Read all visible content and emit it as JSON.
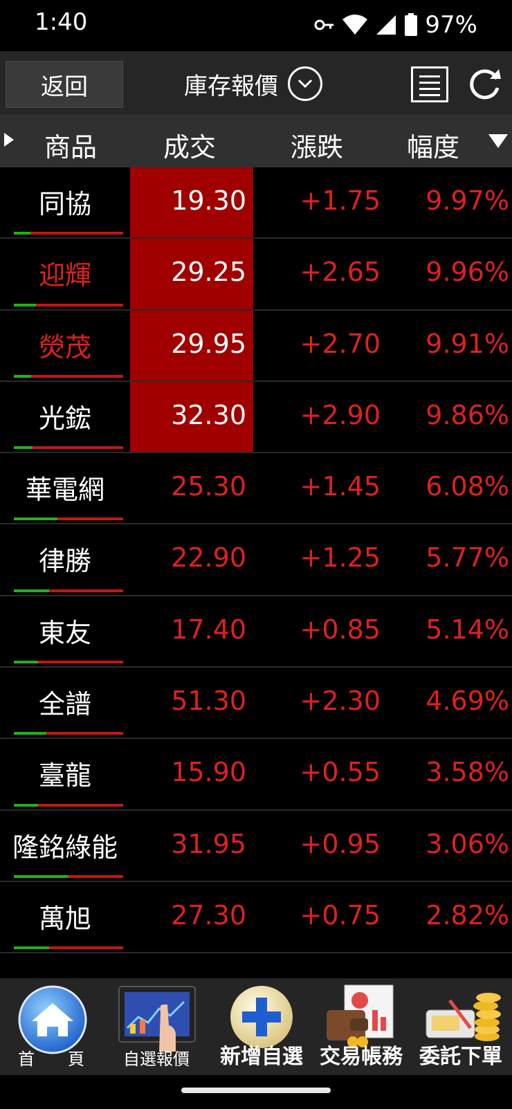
{
  "status_bar": {
    "time": "1:40",
    "battery": "97%",
    "icons": [
      "key-icon",
      "wifi-icon",
      "signal-icon",
      "battery-icon"
    ]
  },
  "title_bar": {
    "back_label": "返回",
    "title": "庫存報價",
    "icons": [
      "chevron-down-circle-icon",
      "list-icon",
      "refresh-icon"
    ]
  },
  "table": {
    "headers": [
      "商品",
      "成交",
      "漲跌",
      "幅度"
    ],
    "rows": [
      {
        "name": "同協",
        "price": "19.30",
        "change": "+1.75",
        "percent": "9.97%",
        "name_color": "#ffffff",
        "highlight": true,
        "green_ratio": 0.15
      },
      {
        "name": "迎輝",
        "price": "29.25",
        "change": "+2.65",
        "percent": "9.96%",
        "name_color": "#e02020",
        "highlight": true,
        "green_ratio": 0.2
      },
      {
        "name": "熒茂",
        "price": "29.95",
        "change": "+2.70",
        "percent": "9.91%",
        "name_color": "#e02020",
        "highlight": true,
        "green_ratio": 0.16
      },
      {
        "name": "光鋐",
        "price": "32.30",
        "change": "+2.90",
        "percent": "9.86%",
        "name_color": "#ffffff",
        "highlight": true,
        "green_ratio": 0.17
      },
      {
        "name": "華電網",
        "price": "25.30",
        "change": "+1.45",
        "percent": "6.08%",
        "name_color": "#ffffff",
        "highlight": false,
        "green_ratio": 0.4
      },
      {
        "name": "律勝",
        "price": "22.90",
        "change": "+1.25",
        "percent": "5.77%",
        "name_color": "#ffffff",
        "highlight": false,
        "green_ratio": 0.32
      },
      {
        "name": "東友",
        "price": "17.40",
        "change": "+0.85",
        "percent": "5.14%",
        "name_color": "#ffffff",
        "highlight": false,
        "green_ratio": 0.22
      },
      {
        "name": "全譜",
        "price": "51.30",
        "change": "+2.30",
        "percent": "4.69%",
        "name_color": "#ffffff",
        "highlight": false,
        "green_ratio": 0.3
      },
      {
        "name": "臺龍",
        "price": "15.90",
        "change": "+0.55",
        "percent": "3.58%",
        "name_color": "#ffffff",
        "highlight": false,
        "green_ratio": 0.22
      },
      {
        "name": "隆銘綠能",
        "price": "31.95",
        "change": "+0.95",
        "percent": "3.06%",
        "name_color": "#ffffff",
        "highlight": false,
        "green_ratio": 0.5
      },
      {
        "name": "萬旭",
        "price": "27.30",
        "change": "+0.75",
        "percent": "2.82%",
        "name_color": "#ffffff",
        "highlight": false,
        "green_ratio": 0.32
      }
    ]
  },
  "colors": {
    "up_red": "#e02020",
    "highlight_bg": "#a00000",
    "header_bg": "#303030",
    "title_bg": "#262626"
  },
  "bottom_nav": [
    {
      "label": "首　　頁",
      "icon": "home-icon"
    },
    {
      "label": "自選報價",
      "icon": "tablet-chart-icon"
    },
    {
      "label": "新增自選",
      "icon": "plus-circle-icon"
    },
    {
      "label": "交易帳務",
      "icon": "wallet-report-icon"
    },
    {
      "label": "委託下單",
      "icon": "coins-order-icon"
    }
  ]
}
